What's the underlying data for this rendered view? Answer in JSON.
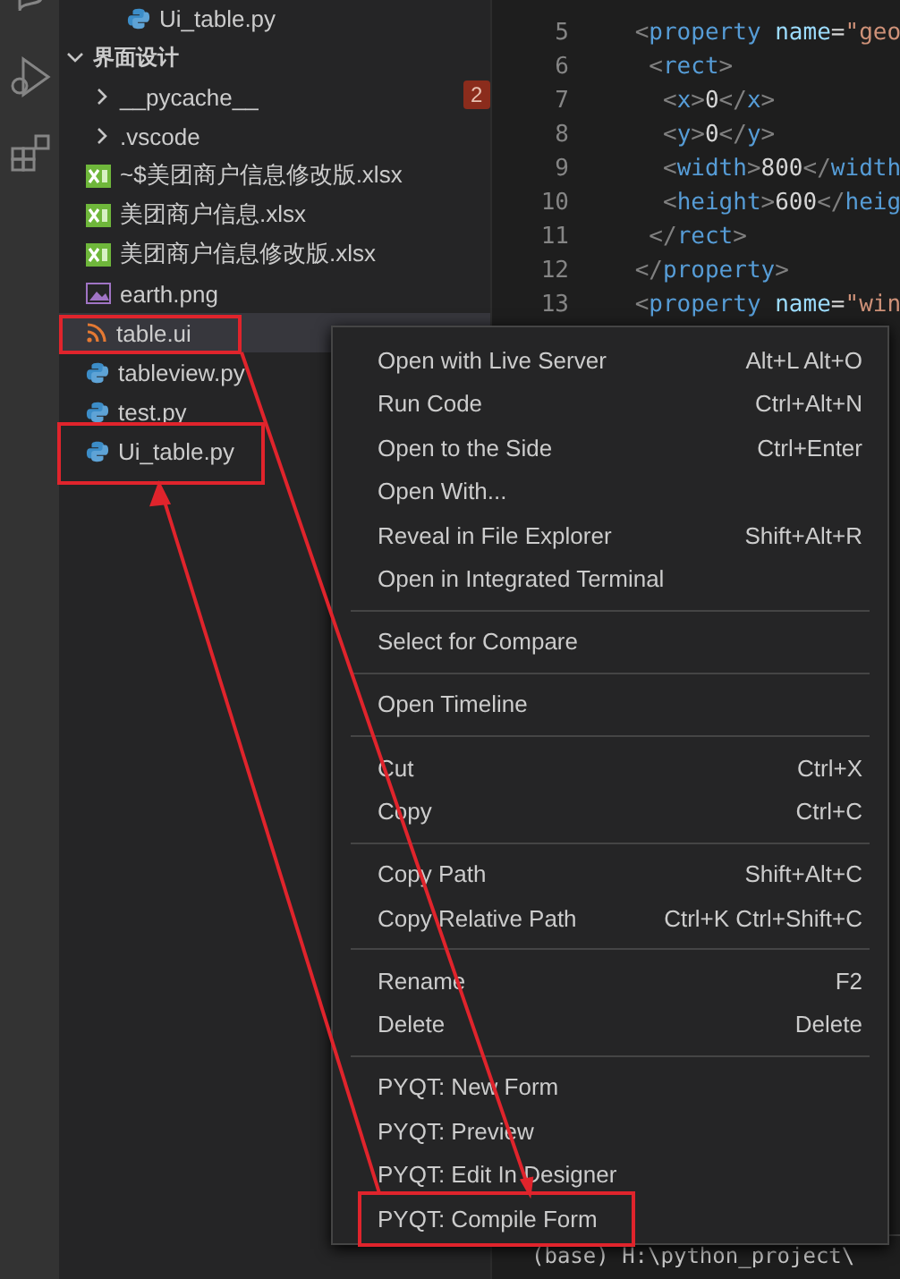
{
  "activity_bar": {
    "items": [
      {
        "kind": "source-control"
      },
      {
        "kind": "run"
      },
      {
        "kind": "extensions"
      }
    ]
  },
  "explorer": {
    "upper_files": [
      {
        "label": "Ui_table.py",
        "kind": "python",
        "selected": false
      }
    ],
    "folder": {
      "label": "界面设计",
      "expanded": true,
      "children": [
        {
          "label": "__pycache__",
          "kind": "folder",
          "expanded": false,
          "badge": "2",
          "selected": false
        },
        {
          "label": ".vscode",
          "kind": "folder",
          "expanded": false,
          "selected": false
        },
        {
          "label": "~$美团商户信息修改版.xlsx",
          "kind": "excel",
          "selected": false
        },
        {
          "label": "美团商户信息.xlsx",
          "kind": "excel",
          "selected": false
        },
        {
          "label": "美团商户信息修改版.xlsx",
          "kind": "excel",
          "selected": false
        },
        {
          "label": "earth.png",
          "kind": "image",
          "selected": false
        },
        {
          "label": "table.ui",
          "kind": "ui",
          "selected": true
        },
        {
          "label": "tableview.py",
          "kind": "python",
          "selected": false
        },
        {
          "label": "test.py",
          "kind": "python",
          "selected": false
        },
        {
          "label": "Ui_table.py",
          "kind": "python",
          "selected": false
        }
      ]
    }
  },
  "editor": {
    "lines": [
      {
        "number": "5",
        "code": " <property name=\"geo"
      },
      {
        "number": "6",
        "code": "  <rect>"
      },
      {
        "number": "7",
        "code": "   <x>0</x>"
      },
      {
        "number": "8",
        "code": "   <y>0</y>"
      },
      {
        "number": "9",
        "code": "   <width>800</width"
      },
      {
        "number": "10",
        "code": "   <height>600</heig"
      },
      {
        "number": "11",
        "code": "  </rect>"
      },
      {
        "number": "12",
        "code": " </property>"
      },
      {
        "number": "13",
        "code": " <property name=\"win"
      }
    ]
  },
  "terminal": {
    "text": "(base) H:\\python_project\\"
  },
  "context_menu": {
    "groups": [
      [
        {
          "label": "Open with Live Server",
          "shortcut": "Alt+L Alt+O"
        },
        {
          "label": "Run Code",
          "shortcut": "Ctrl+Alt+N"
        },
        {
          "label": "Open to the Side",
          "shortcut": "Ctrl+Enter"
        },
        {
          "label": "Open With..."
        },
        {
          "label": "Reveal in File Explorer",
          "shortcut": "Shift+Alt+R"
        },
        {
          "label": "Open in Integrated Terminal"
        }
      ],
      [
        {
          "label": "Select for Compare"
        }
      ],
      [
        {
          "label": "Open Timeline"
        }
      ],
      [
        {
          "label": "Cut",
          "shortcut": "Ctrl+X"
        },
        {
          "label": "Copy",
          "shortcut": "Ctrl+C"
        }
      ],
      [
        {
          "label": "Copy Path",
          "shortcut": "Shift+Alt+C"
        },
        {
          "label": "Copy Relative Path",
          "shortcut": "Ctrl+K Ctrl+Shift+C"
        }
      ],
      [
        {
          "label": "Rename",
          "shortcut": "F2"
        },
        {
          "label": "Delete",
          "shortcut": "Delete"
        }
      ],
      [
        {
          "label": "PYQT: New Form"
        },
        {
          "label": "PYQT: Preview"
        },
        {
          "label": "PYQT: Edit In Designer"
        },
        {
          "label": "PYQT: Compile Form"
        }
      ]
    ]
  }
}
